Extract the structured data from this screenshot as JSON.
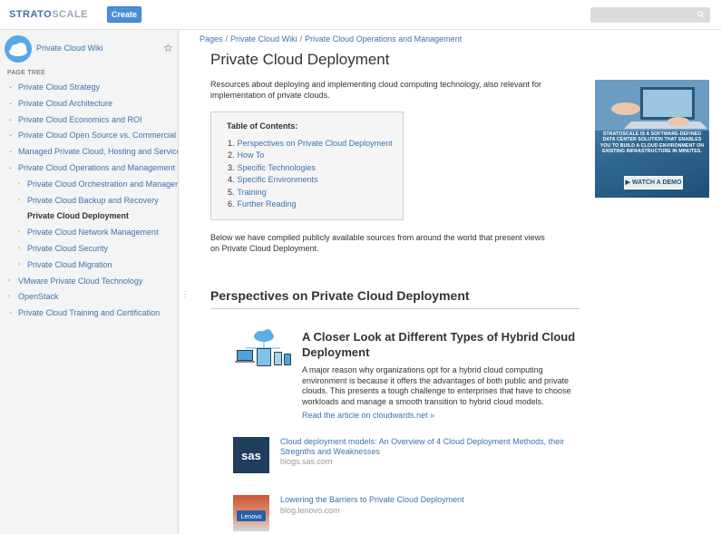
{
  "header": {
    "logo_text": "STRATOSCALE",
    "create_label": "Create",
    "search_placeholder": ""
  },
  "sidebar": {
    "space_name": "Private Cloud Wiki",
    "tree_title": "PAGE TREE",
    "items": [
      {
        "label": "Private Cloud Strategy",
        "level": 1,
        "current": false
      },
      {
        "label": "Private Cloud Architecture",
        "level": 1,
        "current": false
      },
      {
        "label": "Private Cloud Economics and ROI",
        "level": 1,
        "current": false
      },
      {
        "label": "Private Cloud Open Source vs. Commercial",
        "level": 1,
        "current": false
      },
      {
        "label": "Managed Private Cloud, Hosting and Services",
        "level": 1,
        "current": false
      },
      {
        "label": "Private Cloud Operations and Management",
        "level": 1,
        "current": false
      },
      {
        "label": "Private Cloud Orchestration and Management",
        "level": 2,
        "current": false
      },
      {
        "label": "Private Cloud Backup and Recovery",
        "level": 2,
        "current": false
      },
      {
        "label": "Private Cloud Deployment",
        "level": 2,
        "current": true
      },
      {
        "label": "Private Cloud Network Management",
        "level": 2,
        "current": false
      },
      {
        "label": "Private Cloud Security",
        "level": 2,
        "current": false
      },
      {
        "label": "Private Cloud Migration",
        "level": 2,
        "current": false
      },
      {
        "label": "VMware Private Cloud Technology",
        "level": 1,
        "current": false
      },
      {
        "label": "OpenStack",
        "level": 1,
        "current": false
      },
      {
        "label": "Private Cloud Training and Certification",
        "level": 1,
        "current": false
      }
    ]
  },
  "breadcrumb": [
    "Pages",
    "Private Cloud Wiki",
    "Private Cloud Operations and Management"
  ],
  "main": {
    "title": "Private Cloud Deployment",
    "intro": "Resources about deploying and implementing cloud computing technology, also relevant for implementation of private clouds.",
    "toc_title": "Table of Contents:",
    "toc": [
      "Perspectives on Private Cloud Deployment",
      "How To",
      "Specific Technologies",
      "Specific Environments",
      "Training",
      "Further Reading"
    ],
    "below_text": "Below we have compiled publicly available sources from around the world that present views on Private Cloud Deployment.",
    "section_heading": "Perspectives on Private Cloud Deployment",
    "feature": {
      "title": "A Closer Look at Different Types of Hybrid Cloud Deployment",
      "body": "A major reason why organizations opt for a hybrid cloud computing environment is because it offers the advantages of both public and private clouds. This presents a tough challenge to enterprises that have to choose workloads and manage a smooth transition to hybrid cloud models.",
      "link": "Read the article on cloudwards.net »"
    },
    "refs": [
      {
        "title": "Cloud deployment models: An Overview of 4 Cloud Deployment Methods, their Stregnths and Weaknesses",
        "source": "blogs.sas.com",
        "thumb_label": "sas"
      },
      {
        "title": "Lowering the Barriers to Private Cloud Deployment",
        "source": "blog.lenovo.com",
        "thumb_label": "Lenovo"
      }
    ]
  },
  "ad": {
    "text": "STRATOSCALE IS A SOFTWARE-DEFINED DATA CENTER SOLUTION THAT ENABLES YOU TO BUILD A CLOUD ENVIRONMENT ON EXISTING INFRASTRUCTURE IN MINUTES.",
    "button": "WATCH A DEMO"
  },
  "colors": {
    "link": "#3b73af",
    "create_button": "#4a90d9",
    "sidebar_bg": "#f3f4f5",
    "ad_bg": "#2f6791"
  }
}
